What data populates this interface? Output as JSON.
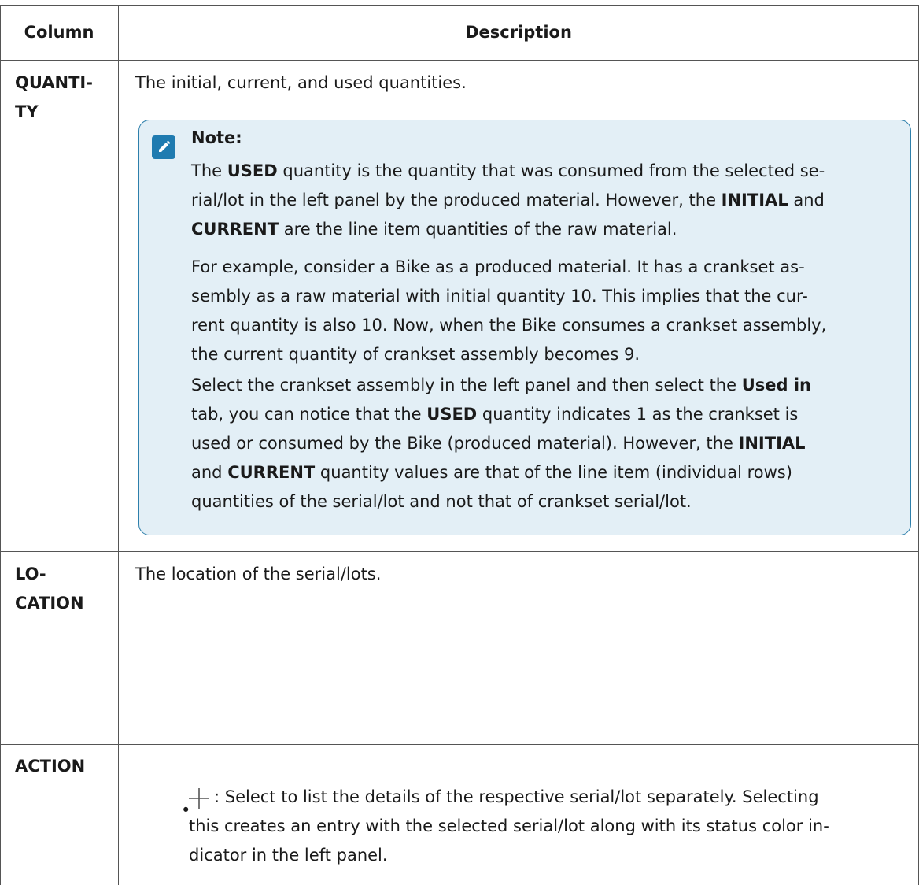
{
  "table": {
    "headers": {
      "column": "Column",
      "description": "Description"
    },
    "rows": [
      {
        "column_line1": "QUANTI-",
        "column_line2": "TY",
        "description": "The initial, current, and used quantities.",
        "note": {
          "icon": "pencil-note-icon",
          "title": "Note:",
          "para1": {
            "l1a": "The ",
            "l1b": "USED",
            "l1c": " quantity is the quantity that was consumed from the selected se-",
            "l2a": "rial/lot in the left panel by the produced material. However, the ",
            "l2b": "INITIAL",
            "l2c": " and",
            "l3a": "CURRENT",
            "l3b": " are the line item quantities of the raw material."
          },
          "para2": {
            "l1": "For example, consider a Bike as a produced material. It has a crankset as-",
            "l2": "sembly as a raw material with initial quantity 10. This implies that the cur-",
            "l3": "rent quantity is also 10. Now, when the Bike consumes a crankset assembly,",
            "l4": "the current quantity of crankset assembly becomes 9."
          },
          "para3": {
            "l1a": "Select the crankset assembly in the left panel and then select the ",
            "l1b": "Used in",
            "l2a": "tab, you can notice that the ",
            "l2b": "USED",
            "l2c": " quantity indicates 1 as the crankset is",
            "l3a": "used or consumed by the Bike (produced material). However, the ",
            "l3b": "INITIAL",
            "l4a": "and ",
            "l4b": "CURRENT",
            "l4c": " quantity values are that of the line item (individual rows)",
            "l5": "quantities of the serial/lot and not that of crankset serial/lot."
          }
        }
      },
      {
        "column_line1": "LO-",
        "column_line2": "CATION",
        "description": "The location of the serial/lots."
      },
      {
        "column": "ACTION",
        "bullet": "•",
        "icon": "plus-icon",
        "text": {
          "l1": ": Select to list the details of the respective serial/lot separately. Selecting",
          "l2": "this creates an entry with the selected serial/lot along with its status color in-",
          "l3": "dicator in the left panel."
        }
      }
    ]
  }
}
